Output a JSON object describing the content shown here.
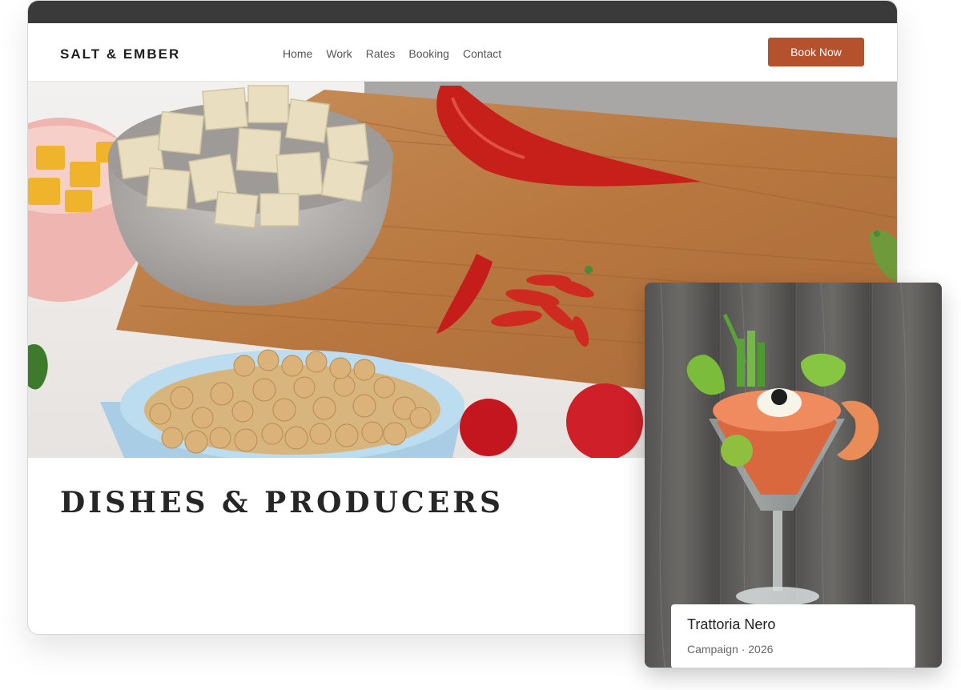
{
  "brand": {
    "name": "SALT & EMBER"
  },
  "nav": {
    "items": [
      {
        "label": "Home"
      },
      {
        "label": "Work"
      },
      {
        "label": "Rates"
      },
      {
        "label": "Booking"
      },
      {
        "label": "Contact"
      }
    ],
    "cta_label": "Book Now"
  },
  "hero": {
    "image_icon": "food-photo-icon"
  },
  "section": {
    "heading": "DISHES & PRODUCERS"
  },
  "feature_card": {
    "image_icon": "cocktail-photo-icon",
    "title": "Trattoria Nero",
    "subtitle": "Campaign · 2026"
  },
  "colors": {
    "accent": "#b5512d",
    "titlebar": "#3a3a3a",
    "heading": "#262626"
  }
}
